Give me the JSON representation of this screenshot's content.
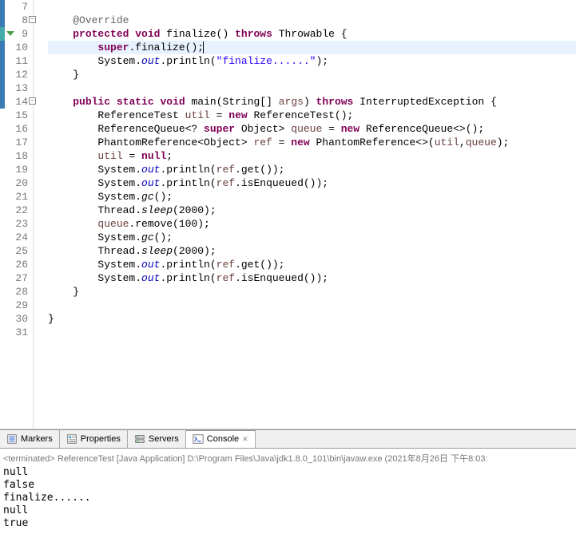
{
  "editor": {
    "lines": [
      {
        "num": "7",
        "marker": "blue",
        "tokens": []
      },
      {
        "num": "8",
        "marker": "blue",
        "fold": true,
        "tokens": [
          {
            "t": "    ",
            "c": ""
          },
          {
            "t": "@Override",
            "c": "ann"
          }
        ]
      },
      {
        "num": "9",
        "marker": "teal",
        "override": true,
        "tokens": [
          {
            "t": "    ",
            "c": ""
          },
          {
            "t": "protected",
            "c": "kw"
          },
          {
            "t": " ",
            "c": ""
          },
          {
            "t": "void",
            "c": "kw"
          },
          {
            "t": " finalize() ",
            "c": ""
          },
          {
            "t": "throws",
            "c": "kw"
          },
          {
            "t": " Throwable {",
            "c": ""
          }
        ]
      },
      {
        "num": "10",
        "marker": "blue",
        "highlight": true,
        "cursor": true,
        "tokens": [
          {
            "t": "        ",
            "c": ""
          },
          {
            "t": "super",
            "c": "kw"
          },
          {
            "t": ".finalize();",
            "c": ""
          }
        ]
      },
      {
        "num": "11",
        "marker": "blue",
        "tokens": [
          {
            "t": "        System.",
            "c": ""
          },
          {
            "t": "out",
            "c": "field-static"
          },
          {
            "t": ".println(",
            "c": ""
          },
          {
            "t": "\"finalize......\"",
            "c": "str"
          },
          {
            "t": ");",
            "c": ""
          }
        ]
      },
      {
        "num": "12",
        "marker": "blue",
        "tokens": [
          {
            "t": "    }",
            "c": ""
          }
        ]
      },
      {
        "num": "13",
        "marker": "blue",
        "tokens": []
      },
      {
        "num": "14",
        "marker": "blue",
        "fold": true,
        "tokens": [
          {
            "t": "    ",
            "c": ""
          },
          {
            "t": "public",
            "c": "kw"
          },
          {
            "t": " ",
            "c": ""
          },
          {
            "t": "static",
            "c": "kw"
          },
          {
            "t": " ",
            "c": ""
          },
          {
            "t": "void",
            "c": "kw"
          },
          {
            "t": " main(String[] ",
            "c": ""
          },
          {
            "t": "args",
            "c": "param"
          },
          {
            "t": ") ",
            "c": ""
          },
          {
            "t": "throws",
            "c": "kw"
          },
          {
            "t": " InterruptedException {",
            "c": ""
          }
        ]
      },
      {
        "num": "15",
        "tokens": [
          {
            "t": "        ReferenceTest ",
            "c": ""
          },
          {
            "t": "util",
            "c": "local"
          },
          {
            "t": " = ",
            "c": ""
          },
          {
            "t": "new",
            "c": "kw"
          },
          {
            "t": " ReferenceTest();",
            "c": ""
          }
        ]
      },
      {
        "num": "16",
        "tokens": [
          {
            "t": "        ReferenceQueue<? ",
            "c": ""
          },
          {
            "t": "super",
            "c": "kw"
          },
          {
            "t": " Object> ",
            "c": ""
          },
          {
            "t": "queue",
            "c": "local"
          },
          {
            "t": " = ",
            "c": ""
          },
          {
            "t": "new",
            "c": "kw"
          },
          {
            "t": " ReferenceQueue<>();",
            "c": ""
          }
        ]
      },
      {
        "num": "17",
        "tokens": [
          {
            "t": "        PhantomReference<Object> ",
            "c": ""
          },
          {
            "t": "ref",
            "c": "local"
          },
          {
            "t": " = ",
            "c": ""
          },
          {
            "t": "new",
            "c": "kw"
          },
          {
            "t": " PhantomReference<>(",
            "c": ""
          },
          {
            "t": "util",
            "c": "local"
          },
          {
            "t": ",",
            "c": ""
          },
          {
            "t": "queue",
            "c": "local"
          },
          {
            "t": ");",
            "c": ""
          }
        ]
      },
      {
        "num": "18",
        "tokens": [
          {
            "t": "        ",
            "c": ""
          },
          {
            "t": "util",
            "c": "local"
          },
          {
            "t": " = ",
            "c": ""
          },
          {
            "t": "null",
            "c": "kw"
          },
          {
            "t": ";",
            "c": ""
          }
        ]
      },
      {
        "num": "19",
        "tokens": [
          {
            "t": "        System.",
            "c": ""
          },
          {
            "t": "out",
            "c": "field-static"
          },
          {
            "t": ".println(",
            "c": ""
          },
          {
            "t": "ref",
            "c": "local"
          },
          {
            "t": ".get());",
            "c": ""
          }
        ]
      },
      {
        "num": "20",
        "tokens": [
          {
            "t": "        System.",
            "c": ""
          },
          {
            "t": "out",
            "c": "field-static"
          },
          {
            "t": ".println(",
            "c": ""
          },
          {
            "t": "ref",
            "c": "local"
          },
          {
            "t": ".isEnqueued());",
            "c": ""
          }
        ]
      },
      {
        "num": "21",
        "tokens": [
          {
            "t": "        System.",
            "c": ""
          },
          {
            "t": "gc",
            "c": "method"
          },
          {
            "t": "();",
            "c": ""
          }
        ],
        "italicGc": true
      },
      {
        "num": "22",
        "tokens": [
          {
            "t": "        Thread.",
            "c": ""
          },
          {
            "t": "sleep",
            "c": ""
          },
          {
            "t": "(2000);",
            "c": ""
          }
        ],
        "italicSleep": true
      },
      {
        "num": "23",
        "tokens": [
          {
            "t": "        ",
            "c": ""
          },
          {
            "t": "queue",
            "c": "local"
          },
          {
            "t": ".remove(100);",
            "c": ""
          }
        ]
      },
      {
        "num": "24",
        "tokens": [
          {
            "t": "        System.",
            "c": ""
          },
          {
            "t": "gc",
            "c": ""
          },
          {
            "t": "();",
            "c": ""
          }
        ],
        "italicGc": true
      },
      {
        "num": "25",
        "tokens": [
          {
            "t": "        Thread.",
            "c": ""
          },
          {
            "t": "sleep",
            "c": ""
          },
          {
            "t": "(2000);",
            "c": ""
          }
        ],
        "italicSleep": true
      },
      {
        "num": "26",
        "tokens": [
          {
            "t": "        System.",
            "c": ""
          },
          {
            "t": "out",
            "c": "field-static"
          },
          {
            "t": ".println(",
            "c": ""
          },
          {
            "t": "ref",
            "c": "local"
          },
          {
            "t": ".get());",
            "c": ""
          }
        ]
      },
      {
        "num": "27",
        "tokens": [
          {
            "t": "        System.",
            "c": ""
          },
          {
            "t": "out",
            "c": "field-static"
          },
          {
            "t": ".println(",
            "c": ""
          },
          {
            "t": "ref",
            "c": "local"
          },
          {
            "t": ".isEnqueued());",
            "c": ""
          }
        ]
      },
      {
        "num": "28",
        "tokens": [
          {
            "t": "    }",
            "c": ""
          }
        ]
      },
      {
        "num": "29",
        "tokens": []
      },
      {
        "num": "30",
        "tokens": [
          {
            "t": "}",
            "c": ""
          }
        ]
      },
      {
        "num": "31",
        "tokens": []
      }
    ]
  },
  "tabs": {
    "items": [
      {
        "label": "Markers",
        "icon": "markers"
      },
      {
        "label": "Properties",
        "icon": "properties"
      },
      {
        "label": "Servers",
        "icon": "servers"
      },
      {
        "label": "Console",
        "icon": "console",
        "active": true
      }
    ]
  },
  "console": {
    "header": "<terminated> ReferenceTest [Java Application] D:\\Program Files\\Java\\jdk1.8.0_101\\bin\\javaw.exe (2021年8月26日 下午8:03:",
    "output": [
      "null",
      "false",
      "finalize......",
      "null",
      "true"
    ]
  }
}
